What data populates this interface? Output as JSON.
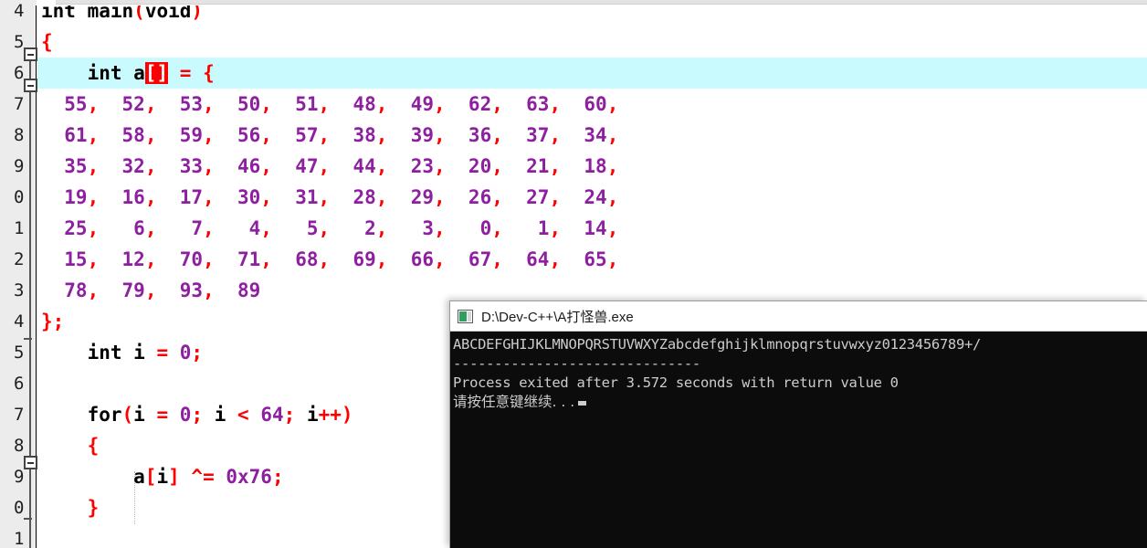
{
  "editor": {
    "name": "dev-cpp-code-editor",
    "highlight_color": "#c9fafd",
    "gutter_bg": "#ececec",
    "number_color": "#8e1fa0",
    "punct_color": "#ff0000",
    "line_numbers": [
      "4",
      "5",
      "6",
      "7",
      "8",
      "9",
      "0",
      "1",
      "2",
      "3",
      "4",
      "5",
      "6",
      "7",
      "8",
      "9",
      "0",
      "1"
    ],
    "lines": [
      {
        "num": "4",
        "highlighted": false,
        "segments": [
          {
            "t": "int main",
            "c": "kw"
          },
          {
            "t": "(",
            "c": "punc"
          },
          {
            "t": "void",
            "c": "kw"
          },
          {
            "t": ")",
            "c": "punc"
          }
        ]
      },
      {
        "num": "5",
        "highlighted": false,
        "segments": [
          {
            "t": "{",
            "c": "punc"
          }
        ]
      },
      {
        "num": "6",
        "highlighted": true,
        "segments": [
          {
            "t": "    int a",
            "c": "kw"
          },
          {
            "t": "[]",
            "c": "sel"
          },
          {
            "t": " ",
            "c": "kw"
          },
          {
            "t": "=",
            "c": "op"
          },
          {
            "t": " ",
            "c": "kw"
          },
          {
            "t": "{",
            "c": "punc"
          }
        ]
      },
      {
        "num": "7",
        "highlighted": false,
        "segments": [
          {
            "t": "  55",
            "c": "num"
          },
          {
            "t": ",",
            "c": "punc"
          },
          {
            "t": "  52",
            "c": "num"
          },
          {
            "t": ",",
            "c": "punc"
          },
          {
            "t": "  53",
            "c": "num"
          },
          {
            "t": ",",
            "c": "punc"
          },
          {
            "t": "  50",
            "c": "num"
          },
          {
            "t": ",",
            "c": "punc"
          },
          {
            "t": "  51",
            "c": "num"
          },
          {
            "t": ",",
            "c": "punc"
          },
          {
            "t": "  48",
            "c": "num"
          },
          {
            "t": ",",
            "c": "punc"
          },
          {
            "t": "  49",
            "c": "num"
          },
          {
            "t": ",",
            "c": "punc"
          },
          {
            "t": "  62",
            "c": "num"
          },
          {
            "t": ",",
            "c": "punc"
          },
          {
            "t": "  63",
            "c": "num"
          },
          {
            "t": ",",
            "c": "punc"
          },
          {
            "t": "  60",
            "c": "num"
          },
          {
            "t": ",",
            "c": "punc"
          }
        ]
      },
      {
        "num": "8",
        "highlighted": false,
        "segments": [
          {
            "t": "  61",
            "c": "num"
          },
          {
            "t": ",",
            "c": "punc"
          },
          {
            "t": "  58",
            "c": "num"
          },
          {
            "t": ",",
            "c": "punc"
          },
          {
            "t": "  59",
            "c": "num"
          },
          {
            "t": ",",
            "c": "punc"
          },
          {
            "t": "  56",
            "c": "num"
          },
          {
            "t": ",",
            "c": "punc"
          },
          {
            "t": "  57",
            "c": "num"
          },
          {
            "t": ",",
            "c": "punc"
          },
          {
            "t": "  38",
            "c": "num"
          },
          {
            "t": ",",
            "c": "punc"
          },
          {
            "t": "  39",
            "c": "num"
          },
          {
            "t": ",",
            "c": "punc"
          },
          {
            "t": "  36",
            "c": "num"
          },
          {
            "t": ",",
            "c": "punc"
          },
          {
            "t": "  37",
            "c": "num"
          },
          {
            "t": ",",
            "c": "punc"
          },
          {
            "t": "  34",
            "c": "num"
          },
          {
            "t": ",",
            "c": "punc"
          }
        ]
      },
      {
        "num": "9",
        "highlighted": false,
        "segments": [
          {
            "t": "  35",
            "c": "num"
          },
          {
            "t": ",",
            "c": "punc"
          },
          {
            "t": "  32",
            "c": "num"
          },
          {
            "t": ",",
            "c": "punc"
          },
          {
            "t": "  33",
            "c": "num"
          },
          {
            "t": ",",
            "c": "punc"
          },
          {
            "t": "  46",
            "c": "num"
          },
          {
            "t": ",",
            "c": "punc"
          },
          {
            "t": "  47",
            "c": "num"
          },
          {
            "t": ",",
            "c": "punc"
          },
          {
            "t": "  44",
            "c": "num"
          },
          {
            "t": ",",
            "c": "punc"
          },
          {
            "t": "  23",
            "c": "num"
          },
          {
            "t": ",",
            "c": "punc"
          },
          {
            "t": "  20",
            "c": "num"
          },
          {
            "t": ",",
            "c": "punc"
          },
          {
            "t": "  21",
            "c": "num"
          },
          {
            "t": ",",
            "c": "punc"
          },
          {
            "t": "  18",
            "c": "num"
          },
          {
            "t": ",",
            "c": "punc"
          }
        ]
      },
      {
        "num": "0",
        "highlighted": false,
        "segments": [
          {
            "t": "  19",
            "c": "num"
          },
          {
            "t": ",",
            "c": "punc"
          },
          {
            "t": "  16",
            "c": "num"
          },
          {
            "t": ",",
            "c": "punc"
          },
          {
            "t": "  17",
            "c": "num"
          },
          {
            "t": ",",
            "c": "punc"
          },
          {
            "t": "  30",
            "c": "num"
          },
          {
            "t": ",",
            "c": "punc"
          },
          {
            "t": "  31",
            "c": "num"
          },
          {
            "t": ",",
            "c": "punc"
          },
          {
            "t": "  28",
            "c": "num"
          },
          {
            "t": ",",
            "c": "punc"
          },
          {
            "t": "  29",
            "c": "num"
          },
          {
            "t": ",",
            "c": "punc"
          },
          {
            "t": "  26",
            "c": "num"
          },
          {
            "t": ",",
            "c": "punc"
          },
          {
            "t": "  27",
            "c": "num"
          },
          {
            "t": ",",
            "c": "punc"
          },
          {
            "t": "  24",
            "c": "num"
          },
          {
            "t": ",",
            "c": "punc"
          }
        ]
      },
      {
        "num": "1",
        "highlighted": false,
        "segments": [
          {
            "t": "  25",
            "c": "num"
          },
          {
            "t": ",",
            "c": "punc"
          },
          {
            "t": "   6",
            "c": "num"
          },
          {
            "t": ",",
            "c": "punc"
          },
          {
            "t": "   7",
            "c": "num"
          },
          {
            "t": ",",
            "c": "punc"
          },
          {
            "t": "   4",
            "c": "num"
          },
          {
            "t": ",",
            "c": "punc"
          },
          {
            "t": "   5",
            "c": "num"
          },
          {
            "t": ",",
            "c": "punc"
          },
          {
            "t": "   2",
            "c": "num"
          },
          {
            "t": ",",
            "c": "punc"
          },
          {
            "t": "   3",
            "c": "num"
          },
          {
            "t": ",",
            "c": "punc"
          },
          {
            "t": "   0",
            "c": "num"
          },
          {
            "t": ",",
            "c": "punc"
          },
          {
            "t": "   1",
            "c": "num"
          },
          {
            "t": ",",
            "c": "punc"
          },
          {
            "t": "  14",
            "c": "num"
          },
          {
            "t": ",",
            "c": "punc"
          }
        ]
      },
      {
        "num": "2",
        "highlighted": false,
        "segments": [
          {
            "t": "  15",
            "c": "num"
          },
          {
            "t": ",",
            "c": "punc"
          },
          {
            "t": "  12",
            "c": "num"
          },
          {
            "t": ",",
            "c": "punc"
          },
          {
            "t": "  70",
            "c": "num"
          },
          {
            "t": ",",
            "c": "punc"
          },
          {
            "t": "  71",
            "c": "num"
          },
          {
            "t": ",",
            "c": "punc"
          },
          {
            "t": "  68",
            "c": "num"
          },
          {
            "t": ",",
            "c": "punc"
          },
          {
            "t": "  69",
            "c": "num"
          },
          {
            "t": ",",
            "c": "punc"
          },
          {
            "t": "  66",
            "c": "num"
          },
          {
            "t": ",",
            "c": "punc"
          },
          {
            "t": "  67",
            "c": "num"
          },
          {
            "t": ",",
            "c": "punc"
          },
          {
            "t": "  64",
            "c": "num"
          },
          {
            "t": ",",
            "c": "punc"
          },
          {
            "t": "  65",
            "c": "num"
          },
          {
            "t": ",",
            "c": "punc"
          }
        ]
      },
      {
        "num": "3",
        "highlighted": false,
        "segments": [
          {
            "t": "  78",
            "c": "num"
          },
          {
            "t": ",",
            "c": "punc"
          },
          {
            "t": "  79",
            "c": "num"
          },
          {
            "t": ",",
            "c": "punc"
          },
          {
            "t": "  93",
            "c": "num"
          },
          {
            "t": ",",
            "c": "punc"
          },
          {
            "t": "  89",
            "c": "num"
          }
        ]
      },
      {
        "num": "4",
        "highlighted": false,
        "segments": [
          {
            "t": "};",
            "c": "punc"
          }
        ]
      },
      {
        "num": "5",
        "highlighted": false,
        "segments": [
          {
            "t": "    int i ",
            "c": "kw"
          },
          {
            "t": "=",
            "c": "op"
          },
          {
            "t": " ",
            "c": "kw"
          },
          {
            "t": "0",
            "c": "num"
          },
          {
            "t": ";",
            "c": "punc"
          }
        ]
      },
      {
        "num": "6",
        "highlighted": false,
        "segments": []
      },
      {
        "num": "7",
        "highlighted": false,
        "segments": [
          {
            "t": "    for",
            "c": "kw"
          },
          {
            "t": "(",
            "c": "punc"
          },
          {
            "t": "i ",
            "c": "kw"
          },
          {
            "t": "=",
            "c": "op"
          },
          {
            "t": " ",
            "c": "kw"
          },
          {
            "t": "0",
            "c": "num"
          },
          {
            "t": ";",
            "c": "punc"
          },
          {
            "t": " i ",
            "c": "kw"
          },
          {
            "t": "<",
            "c": "op"
          },
          {
            "t": " ",
            "c": "kw"
          },
          {
            "t": "64",
            "c": "num"
          },
          {
            "t": ";",
            "c": "punc"
          },
          {
            "t": " i",
            "c": "kw"
          },
          {
            "t": "++)",
            "c": "punc"
          }
        ]
      },
      {
        "num": "8",
        "highlighted": false,
        "segments": [
          {
            "t": "    {",
            "c": "punc"
          }
        ]
      },
      {
        "num": "9",
        "highlighted": false,
        "segments": [
          {
            "t": "        a",
            "c": "kw"
          },
          {
            "t": "[",
            "c": "punc"
          },
          {
            "t": "i",
            "c": "kw"
          },
          {
            "t": "]",
            "c": "punc"
          },
          {
            "t": " ",
            "c": "kw"
          },
          {
            "t": "^=",
            "c": "op"
          },
          {
            "t": " ",
            "c": "kw"
          },
          {
            "t": "0x76",
            "c": "num"
          },
          {
            "t": ";",
            "c": "punc"
          }
        ]
      },
      {
        "num": "0",
        "highlighted": false,
        "segments": [
          {
            "t": "    }",
            "c": "punc"
          }
        ]
      },
      {
        "num": "1",
        "highlighted": false,
        "segments": []
      }
    ]
  },
  "console": {
    "title": "D:\\Dev-C++\\A打怪兽.exe",
    "icon": "console-app-icon",
    "background": "#0c0c0c",
    "text_color": "#cccccc",
    "lines": [
      "ABCDEFGHIJKLMNOPQRSTUVWXYZabcdefghijklmnopqrstuvwxyz0123456789+/",
      "------------------------------",
      "Process exited after 3.572 seconds with return value 0",
      "请按任意键继续. . ."
    ]
  }
}
